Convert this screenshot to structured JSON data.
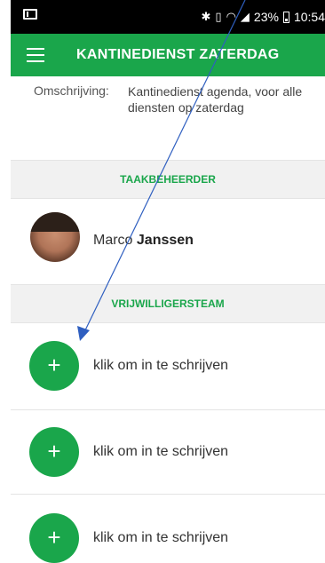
{
  "status_bar": {
    "icons": [
      "mail-icon",
      "bluetooth-icon",
      "vibrate-icon",
      "wifi-icon",
      "signal-icon",
      "battery-icon"
    ],
    "battery": "23%",
    "time": "10:54"
  },
  "app_bar": {
    "title": "KANTINEDIENST ZATERDAG",
    "menu_icon": "hamburger-menu-icon"
  },
  "description": {
    "label": "Omschrijving:",
    "value": "Kantinedienst agenda, voor alle diensten op zaterdag"
  },
  "task_manager": {
    "header": "TAAKBEHEERDER",
    "first_name": "Marco",
    "last_name": "Janssen"
  },
  "volunteers": {
    "header": "VRIJWILLIGERSTEAM",
    "slots": [
      {
        "label": "klik om in te schrijven"
      },
      {
        "label": "klik om in te schrijven"
      },
      {
        "label": "klik om in te schrijven"
      }
    ]
  },
  "colors": {
    "brand": "#1aa64b",
    "annotation_arrow": "#2f5fc0"
  }
}
